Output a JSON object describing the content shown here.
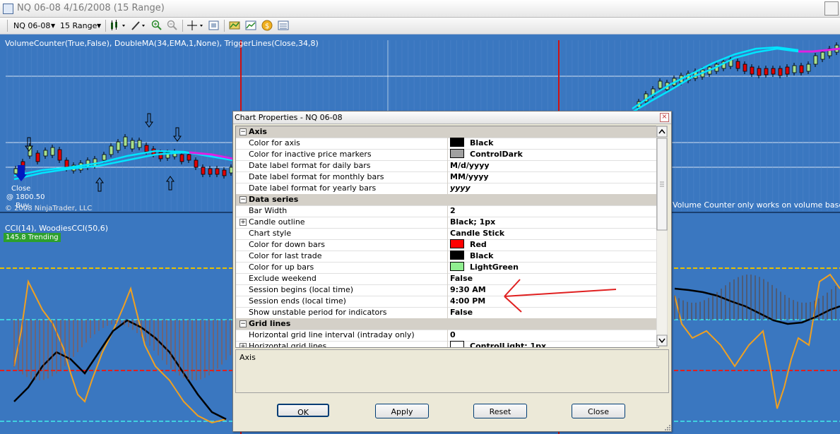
{
  "window": {
    "title": "NQ 06-08  4/16/2008 (15 Range)"
  },
  "toolbar": {
    "instrument": "NQ 06-08",
    "period": "15 Range"
  },
  "chart": {
    "indicator_label": "VolumeCounter(True,False), DoubleMA(34,EMA,1,None), TriggerLines(Close,34,8)",
    "copyright": "© 2008 NinjaTrader, LLC",
    "close_label": "Close",
    "close_price": "@ 1800.50",
    "buy_label": "Buy",
    "volume_note": "Volume Counter only works on volume based inte",
    "cci_label": "CCI(14), WoodiesCCI(50,6)",
    "cci_badge": "145.8 Trending",
    "colors": {
      "background": "#3a77c0",
      "up_bar": "#a8e08c",
      "down_bar": "#e00000",
      "ema": "#00e5ff",
      "trigger": "#e020e0",
      "cci": "#f0a020",
      "woodies": "#000000",
      "session_line": "#d01010"
    }
  },
  "dialog": {
    "title": "Chart Properties - NQ 06-08",
    "description": "Axis",
    "buttons": {
      "ok": "OK",
      "apply": "Apply",
      "reset": "Reset",
      "close": "Close"
    },
    "rows": [
      {
        "kind": "category",
        "name": "Axis"
      },
      {
        "kind": "prop",
        "name": "Color for axis",
        "value": "Black",
        "swatch": "#000000"
      },
      {
        "kind": "prop",
        "name": "Color for inactive price markers",
        "value": "ControlDark",
        "swatch": "#a0a0a0"
      },
      {
        "kind": "prop",
        "name": "Date label format for daily bars",
        "value": "M/d/yyyy"
      },
      {
        "kind": "prop",
        "name": "Date label format for monthly bars",
        "value": "MM/yyyy"
      },
      {
        "kind": "prop",
        "name": "Date label format for yearly bars",
        "value": "yyyy"
      },
      {
        "kind": "category",
        "name": "Data series"
      },
      {
        "kind": "prop",
        "name": "Bar Width",
        "value": "2"
      },
      {
        "kind": "prop",
        "name": "Candle outline",
        "value": "Black; 1px",
        "expandable": true
      },
      {
        "kind": "prop",
        "name": "Chart style",
        "value": "Candle Stick"
      },
      {
        "kind": "prop",
        "name": "Color for down bars",
        "value": "Red",
        "swatch": "#ff0000"
      },
      {
        "kind": "prop",
        "name": "Color for last trade",
        "value": "Black",
        "swatch": "#000000"
      },
      {
        "kind": "prop",
        "name": "Color for up bars",
        "value": "LightGreen",
        "swatch": "#90ee90"
      },
      {
        "kind": "prop",
        "name": "Exclude weekend",
        "value": "False"
      },
      {
        "kind": "prop",
        "name": "Session begins (local time)",
        "value": "9:30 AM"
      },
      {
        "kind": "prop",
        "name": "Session ends (local time)",
        "value": "4:00 PM"
      },
      {
        "kind": "prop",
        "name": "Show unstable period for indicators",
        "value": "False"
      },
      {
        "kind": "category",
        "name": "Grid lines"
      },
      {
        "kind": "prop",
        "name": "Horizontal grid line interval (intraday only)",
        "value": "0"
      },
      {
        "kind": "prop",
        "name": "Horizontal grid lines",
        "value": "ControlLight; 1px",
        "swatch": "#ffffff",
        "expandable": true
      }
    ]
  }
}
